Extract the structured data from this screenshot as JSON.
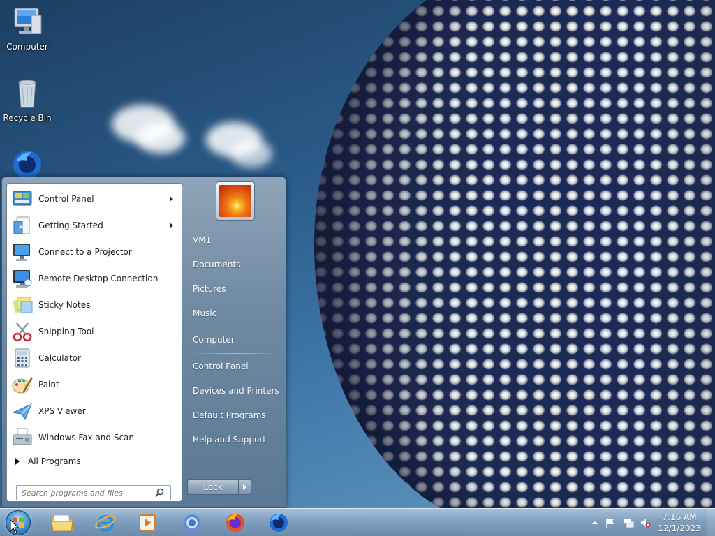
{
  "desktop": {
    "icons": [
      {
        "label": "Computer",
        "icon": "computer-icon"
      },
      {
        "label": "Recycle Bin",
        "icon": "recycle-bin-icon"
      },
      {
        "label": "",
        "icon": "firefox-developer-icon"
      }
    ]
  },
  "start_menu": {
    "programs": [
      {
        "label": "Control Panel",
        "icon": "control-panel-icon",
        "submenu": true
      },
      {
        "label": "Getting Started",
        "icon": "getting-started-icon",
        "submenu": true
      },
      {
        "label": "Connect to a Projector",
        "icon": "projector-icon",
        "submenu": false
      },
      {
        "label": "Remote Desktop Connection",
        "icon": "remote-desktop-icon",
        "submenu": false
      },
      {
        "label": "Sticky Notes",
        "icon": "sticky-notes-icon",
        "submenu": false
      },
      {
        "label": "Snipping Tool",
        "icon": "snipping-tool-icon",
        "submenu": false
      },
      {
        "label": "Calculator",
        "icon": "calculator-icon",
        "submenu": false
      },
      {
        "label": "Paint",
        "icon": "paint-icon",
        "submenu": false
      },
      {
        "label": "XPS Viewer",
        "icon": "xps-viewer-icon",
        "submenu": false
      },
      {
        "label": "Windows Fax and Scan",
        "icon": "fax-scan-icon",
        "submenu": false
      }
    ],
    "all_programs_label": "All Programs",
    "search_placeholder": "Search programs and files",
    "right_items": [
      {
        "label": "VM1"
      },
      {
        "label": "Documents"
      },
      {
        "label": "Pictures"
      },
      {
        "label": "Music"
      },
      {
        "label": "Computer"
      },
      {
        "label": "Control Panel"
      },
      {
        "label": "Devices and Printers"
      },
      {
        "label": "Default Programs"
      },
      {
        "label": "Help and Support"
      }
    ],
    "lock_label": "Lock"
  },
  "taskbar": {
    "pinned": [
      {
        "icon": "file-explorer-icon"
      },
      {
        "icon": "internet-explorer-icon"
      },
      {
        "icon": "media-player-icon"
      },
      {
        "icon": "chrome-icon"
      },
      {
        "icon": "firefox-icon"
      },
      {
        "icon": "firefox-developer-icon"
      }
    ],
    "clock": {
      "time": "7:16 AM",
      "date": "12/1/2023"
    }
  },
  "colors": {
    "accent": "#2a5a88",
    "menu_frame": "#6f8aa2"
  }
}
